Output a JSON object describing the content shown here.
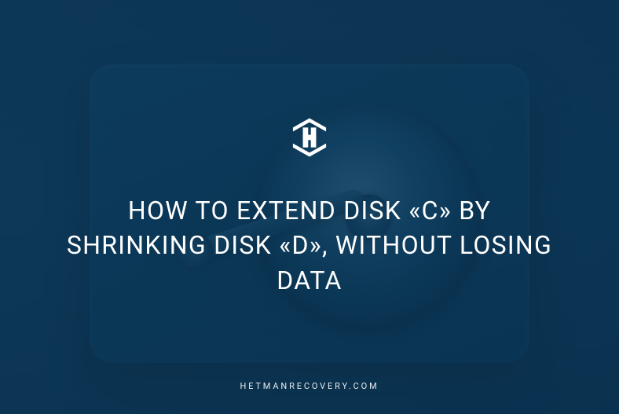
{
  "logo": {
    "name": "hetman-logo-mark",
    "color": "#ffffff"
  },
  "headline": "HOW TO EXTEND DISK «C» BY SHRINKING DISK «D», WITHOUT LOSING DATA",
  "footer": {
    "site": "HETMANRECOVERY.COM"
  },
  "colors": {
    "background": "#0d3a5c",
    "text": "#ffffff"
  }
}
